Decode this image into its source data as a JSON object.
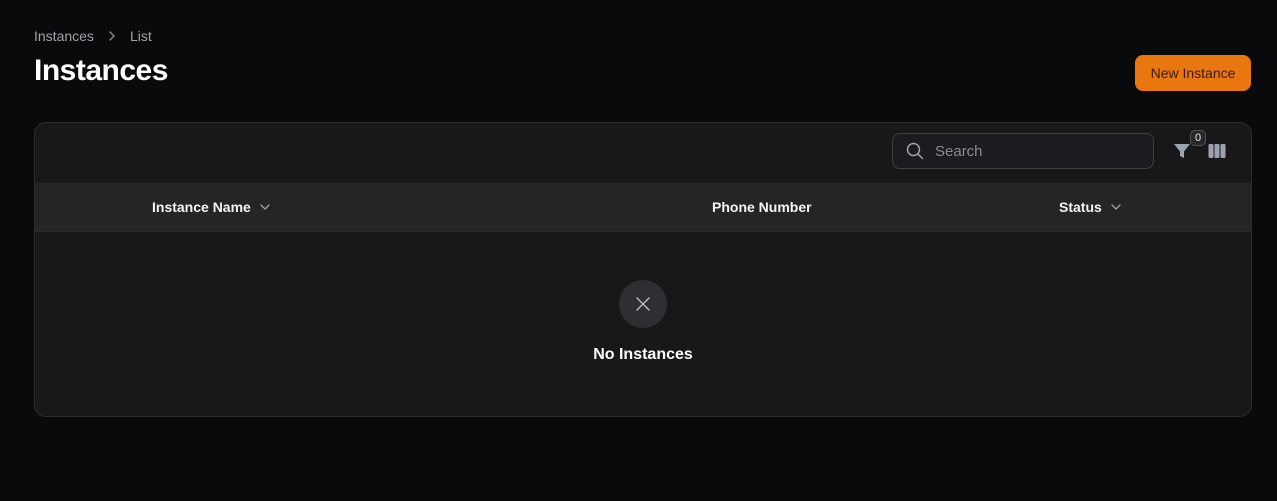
{
  "breadcrumb": {
    "items": [
      "Instances",
      "List"
    ]
  },
  "header": {
    "title": "Instances",
    "new_button_label": "New Instance"
  },
  "toolbar": {
    "search_placeholder": "Search",
    "filter_count": "0",
    "icons": [
      "search-icon",
      "filter-icon",
      "columns-icon"
    ]
  },
  "table": {
    "columns": [
      {
        "label": "Instance Name",
        "sortable": true
      },
      {
        "label": "Phone Number",
        "sortable": false
      },
      {
        "label": "Status",
        "sortable": true
      }
    ],
    "rows": []
  },
  "empty_state": {
    "icon": "x-icon",
    "message": "No Instances"
  },
  "colors": {
    "background": "#0a0a0c",
    "panel": "#18181b",
    "header_row": "#252528",
    "accent": "#e8770f"
  }
}
